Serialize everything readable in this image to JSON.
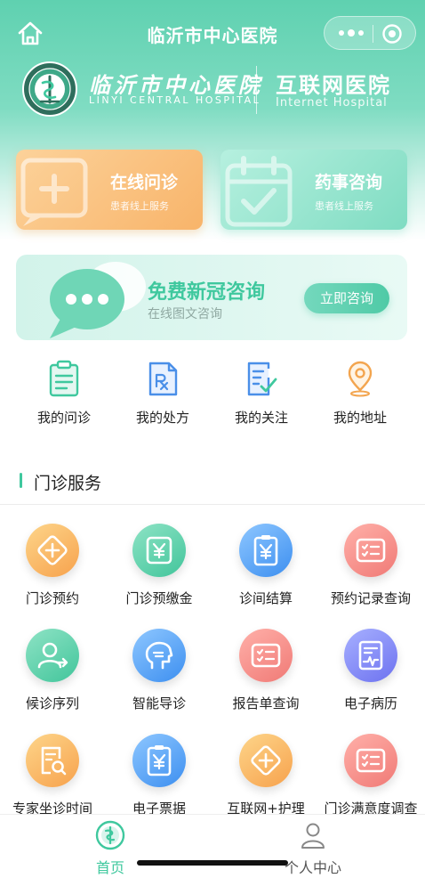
{
  "navbar": {
    "title": "临沂市中心医院"
  },
  "brand": {
    "hospital_name": "临沂市中心医院",
    "hospital_name_en": "LINYI CENTRAL HOSPITAL",
    "internet_title": "互联网医院",
    "internet_title_en": "Internet Hospital"
  },
  "cards": [
    {
      "title": "在线问诊",
      "subtitle": "患者线上服务",
      "icon": "chat-plus-icon",
      "color": "#f8b46a"
    },
    {
      "title": "药事咨询",
      "subtitle": "患者线上服务",
      "icon": "calendar-check-icon",
      "color": "#7fdcc2"
    }
  ],
  "covid": {
    "title": "免费新冠咨询",
    "subtitle": "在线图文咨询",
    "button": "立即咨询"
  },
  "quick_links": [
    {
      "label": "我的问诊",
      "icon": "clipboard-icon"
    },
    {
      "label": "我的处方",
      "icon": "prescription-icon"
    },
    {
      "label": "我的关注",
      "icon": "note-check-icon"
    },
    {
      "label": "我的地址",
      "icon": "location-pin-icon"
    }
  ],
  "section": {
    "title": "门诊服务"
  },
  "services": [
    {
      "label": "门诊预约",
      "icon": "plus-diamond-icon",
      "color": "orange"
    },
    {
      "label": "门诊预缴金",
      "icon": "yuan-receipt-icon",
      "color": "green"
    },
    {
      "label": "诊间结算",
      "icon": "yuan-clipboard-icon",
      "color": "blue"
    },
    {
      "label": "预约记录查询",
      "icon": "list-card-icon",
      "color": "red"
    },
    {
      "label": "候诊序列",
      "icon": "user-queue-icon",
      "color": "green"
    },
    {
      "label": "智能导诊",
      "icon": "head-ai-icon",
      "color": "blue"
    },
    {
      "label": "报告单查询",
      "icon": "report-card-icon",
      "color": "red"
    },
    {
      "label": "电子病历",
      "icon": "medical-record-icon",
      "color": "purple"
    },
    {
      "label": "专家坐诊时间",
      "icon": "doc-search-icon",
      "color": "orange"
    },
    {
      "label": "电子票据",
      "icon": "yuan-receipt-icon",
      "color": "blue"
    },
    {
      "label": "互联网+护理",
      "icon": "plus-diamond-icon",
      "color": "orange"
    },
    {
      "label": "门诊满意度调查",
      "icon": "list-card-icon",
      "color": "red"
    }
  ],
  "tabbar": [
    {
      "label": "首页",
      "icon": "hospital-logo-icon",
      "active": true
    },
    {
      "label": "个人中心",
      "icon": "person-icon",
      "active": false
    }
  ],
  "colors": {
    "brand": "#3fc89e",
    "brand_light": "#7fdcc2",
    "accent_orange": "#f8b46a"
  }
}
